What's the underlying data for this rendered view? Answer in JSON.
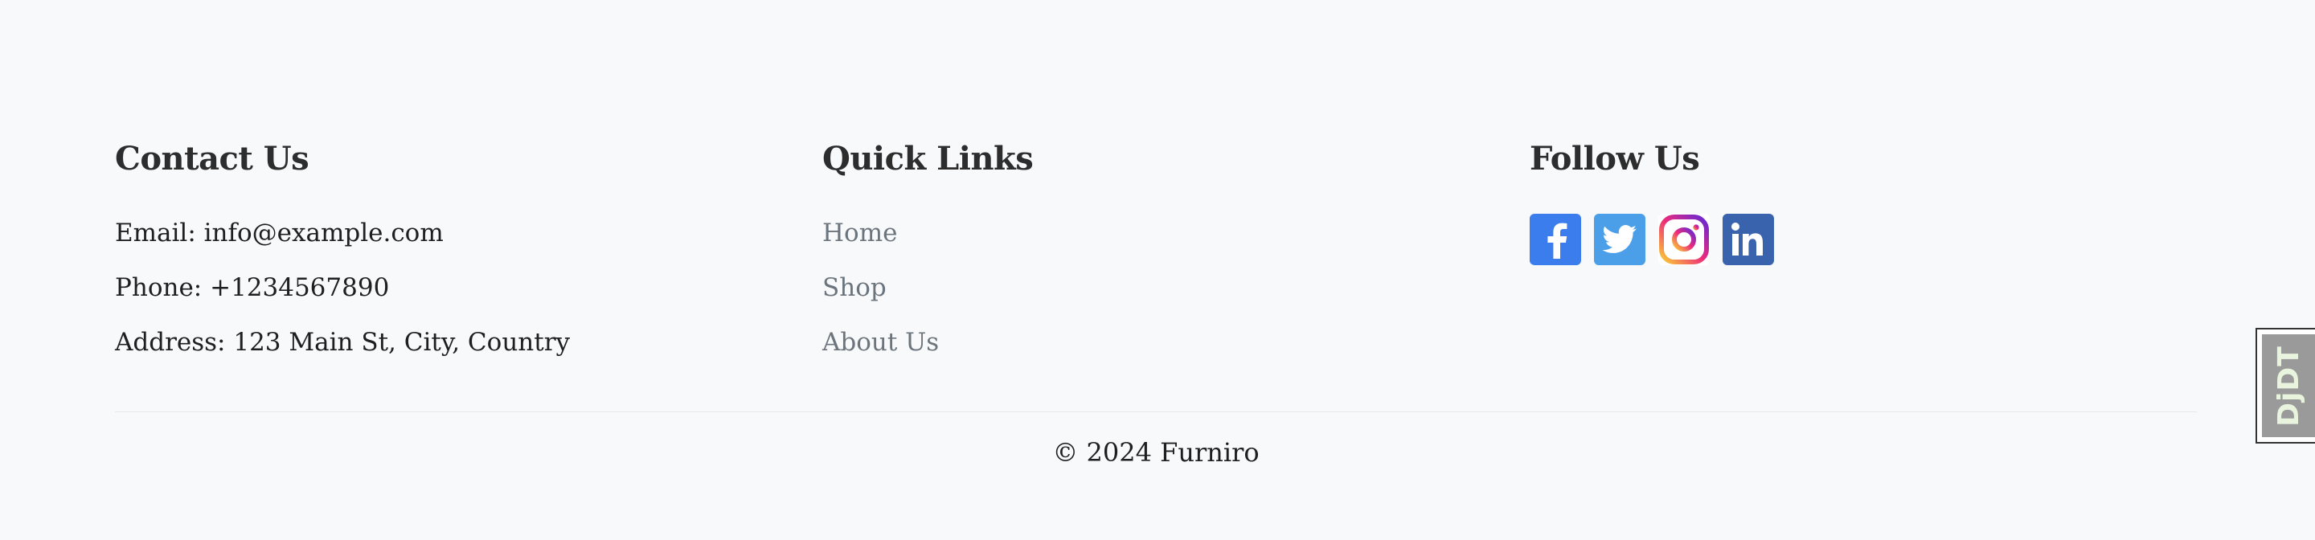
{
  "contact": {
    "heading": "Contact Us",
    "email": "Email: info@example.com",
    "phone": "Phone: +1234567890",
    "address": "Address: 123 Main St, City, Country"
  },
  "quick_links": {
    "heading": "Quick Links",
    "items": [
      "Home",
      "Shop",
      "About Us"
    ]
  },
  "follow": {
    "heading": "Follow Us",
    "icons": [
      "facebook-icon",
      "twitter-icon",
      "instagram-icon",
      "linkedin-icon"
    ],
    "colors": {
      "facebook": "#3b7ded",
      "twitter": "#4a9fe8",
      "instagram_gradient": [
        "#f9ce34",
        "#ee2a7b",
        "#6228d7"
      ],
      "linkedin": "#3a63ad"
    }
  },
  "copyright": "© 2024 Furniro",
  "debug_toolbar": {
    "label": "DjDT"
  },
  "colors": {
    "background": "#f8f9fa",
    "heading": "#2d2d2d",
    "link": "#6c757d",
    "divider": "#e7e8ea"
  }
}
